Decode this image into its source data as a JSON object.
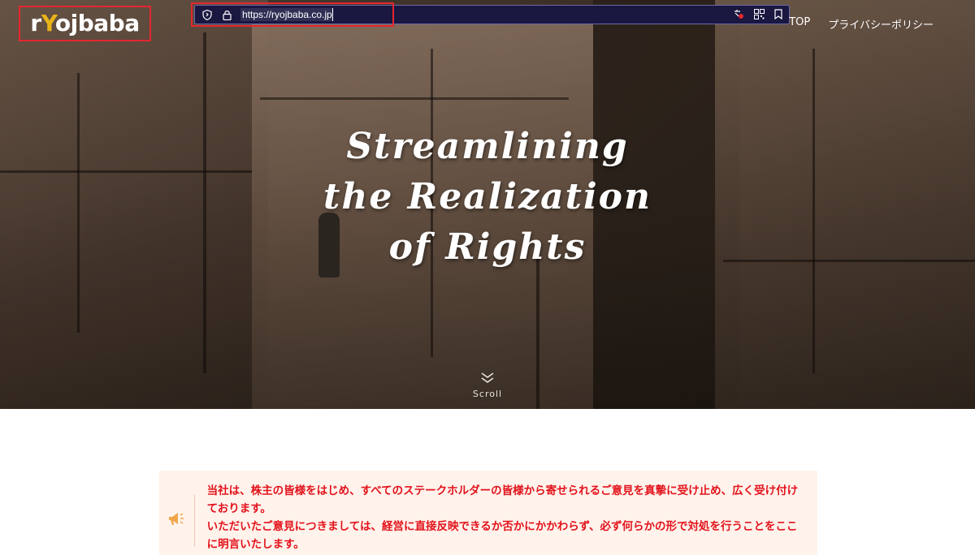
{
  "site": {
    "logo_prefix": "r",
    "logo_accent": "Y",
    "logo_suffix": "ojbaba"
  },
  "browser": {
    "url": "https://ryojbaba.co.jp"
  },
  "nav": {
    "items": [
      {
        "label": "TOP"
      },
      {
        "label": "プライバシーポリシー"
      }
    ]
  },
  "hero": {
    "headline": [
      "Streamlining",
      "the Realization",
      "of Rights"
    ],
    "scroll_label": "Scroll"
  },
  "notice": {
    "paragraphs": [
      "当社は、株主の皆様をはじめ、すべてのステークホルダーの皆様から寄せられるご意見を真摯に受け止め、広く受け付けております。",
      "いただいたご意見につきましては、経営に直接反映できるか否かにかかわらず、必ず何らかの形で対処を行うことをここに明言いたします。"
    ]
  },
  "colors": {
    "accent_red": "#e3121b",
    "logo_yellow": "#e8b21a",
    "notice_bg": "#fff3ec",
    "urlbar_bg": "#1a1740"
  },
  "icons": {
    "security": "shield-icon",
    "lock": "lock-icon",
    "translate": "translate-icon",
    "qr": "qr-code-icon",
    "bookmark": "bookmark-icon",
    "scroll": "chevron-double-down-icon",
    "notice": "megaphone-icon"
  }
}
